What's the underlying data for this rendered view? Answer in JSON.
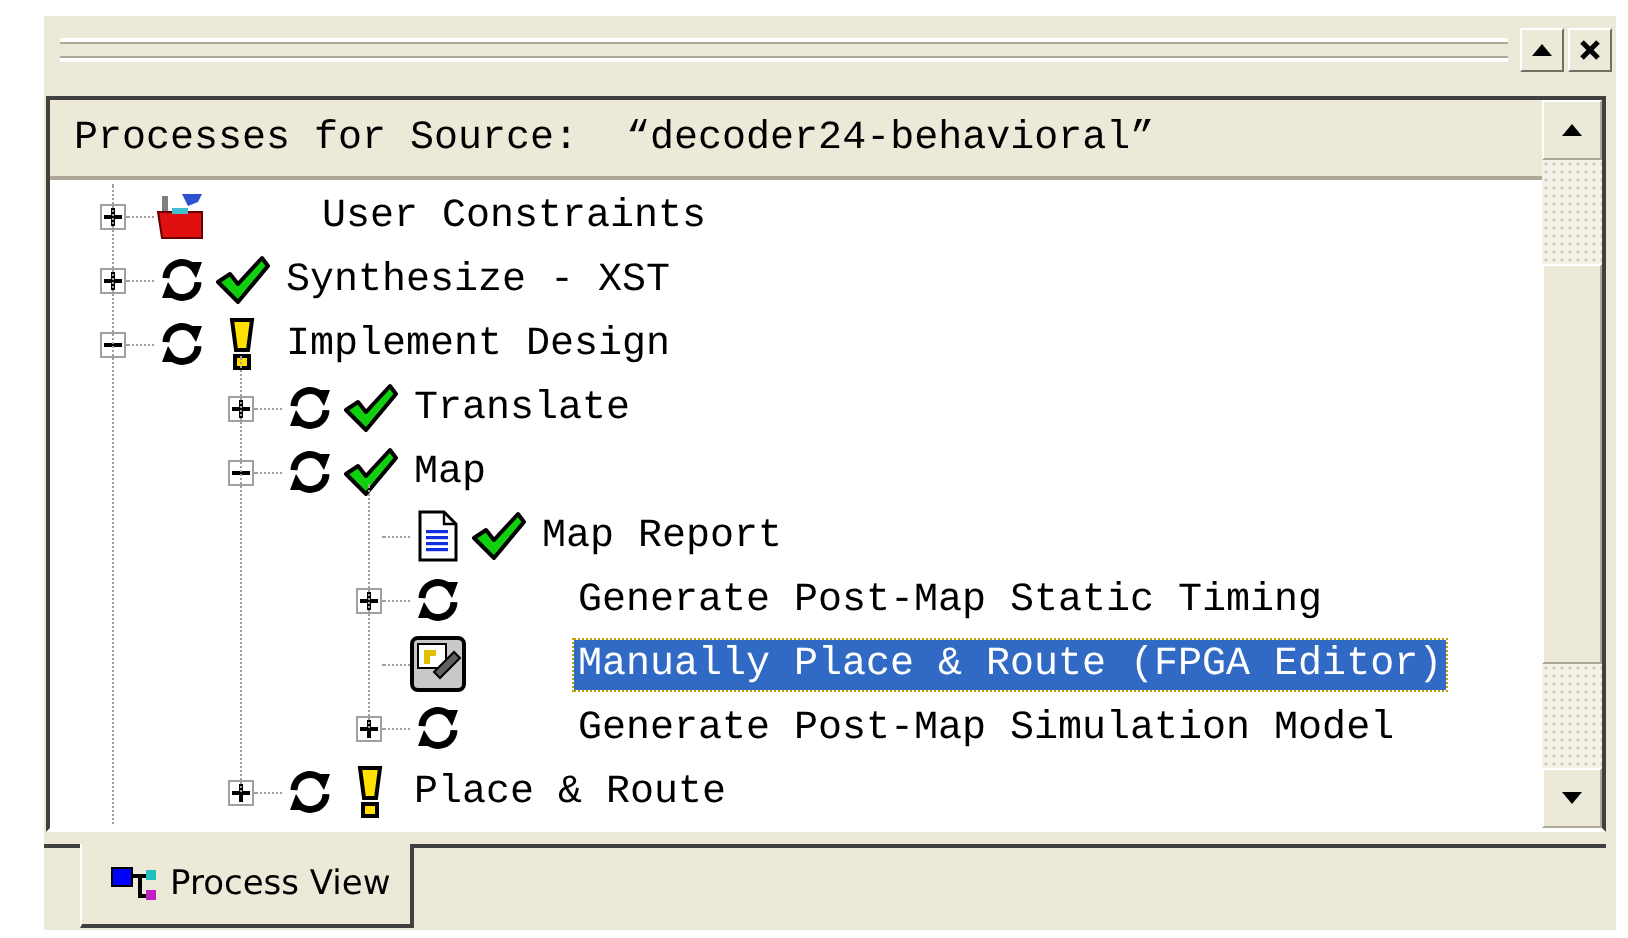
{
  "header": "Processes for Source:  “decoder24-behavioral”",
  "tree": [
    {
      "label": "User Constraints",
      "kind": "toolbox",
      "done": false,
      "warning": false,
      "expandable": true,
      "expanded": false,
      "selected": false
    },
    {
      "label": "Synthesize - XST",
      "kind": "process",
      "done": true,
      "warning": false,
      "expandable": true,
      "expanded": false,
      "selected": false
    },
    {
      "label": "Implement Design",
      "kind": "process",
      "done": false,
      "warning": true,
      "expandable": true,
      "expanded": true,
      "selected": false,
      "children": [
        {
          "label": "Translate",
          "kind": "process",
          "done": true,
          "warning": false,
          "expandable": true,
          "expanded": false,
          "selected": false
        },
        {
          "label": "Map",
          "kind": "process",
          "done": true,
          "warning": false,
          "expandable": true,
          "expanded": true,
          "selected": false,
          "children": [
            {
              "label": "Map Report",
              "kind": "report",
              "done": true,
              "warning": false,
              "expandable": false,
              "selected": false
            },
            {
              "label": "Generate Post-Map Static Timing",
              "kind": "process",
              "done": false,
              "warning": false,
              "expandable": true,
              "expanded": false,
              "selected": false
            },
            {
              "label": "Manually Place & Route (FPGA Editor)",
              "kind": "editor",
              "done": false,
              "warning": false,
              "expandable": false,
              "selected": true
            },
            {
              "label": "Generate Post-Map Simulation Model",
              "kind": "process",
              "done": false,
              "warning": false,
              "expandable": true,
              "expanded": false,
              "selected": false
            }
          ]
        },
        {
          "label": "Place & Route",
          "kind": "process",
          "done": false,
          "warning": true,
          "expandable": true,
          "expanded": false,
          "selected": false
        }
      ]
    }
  ],
  "tabs": [
    {
      "label": "Process View",
      "selected": true
    }
  ]
}
